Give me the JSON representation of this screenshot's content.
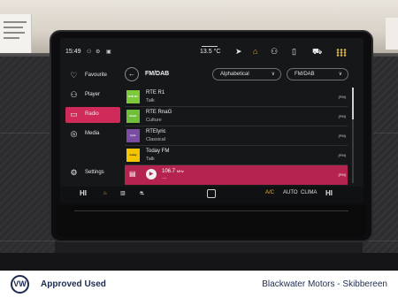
{
  "status": {
    "time": "15:49",
    "temperature": "13.5 °C"
  },
  "sidebar": {
    "items": [
      {
        "label": "Favourite",
        "icon": "heart-icon",
        "active": false
      },
      {
        "label": "Player",
        "icon": "person-icon",
        "active": false
      },
      {
        "label": "Radio",
        "icon": "radio-icon",
        "active": true
      },
      {
        "label": "Media",
        "icon": "media-icon",
        "active": false
      },
      {
        "label": "Settings",
        "icon": "gear-icon",
        "active": false
      }
    ]
  },
  "header": {
    "title": "FM/DAB",
    "sort_value": "Alphabetical",
    "band_value": "FM/DAB"
  },
  "stations": [
    {
      "name": "RTE R1",
      "genre": "Talk",
      "band": "(FM)",
      "logo": "RTÉ R1",
      "logo_color": "#7ec93a"
    },
    {
      "name": "RTE RnaG",
      "genre": "Culture",
      "band": "(FM)",
      "logo": "RnaG",
      "logo_color": "#6fbf3a"
    },
    {
      "name": "RTElyric",
      "genre": "Classical",
      "band": "(FM)",
      "logo": "lyric",
      "logo_color": "#7a4da3"
    },
    {
      "name": "Today FM",
      "genre": "Talk",
      "band": "(FM)",
      "logo": "today",
      "logo_color": "#f2c500"
    }
  ],
  "now_playing": {
    "frequency": "106.7",
    "unit": "MHz",
    "subtitle": "---",
    "band": "(FM)"
  },
  "bottom_bar": {
    "hi_left": "HI",
    "ac": "A/C",
    "auto": "AUTO",
    "clima": "CLIMA",
    "hi_right": "HI"
  },
  "footer": {
    "logo": "VW",
    "approved": "Approved Used",
    "dealer": "Blackwater Motors - Skibbereen"
  },
  "colors": {
    "accent": "#cf2a5a",
    "brand_navy": "#1d2b4f"
  }
}
